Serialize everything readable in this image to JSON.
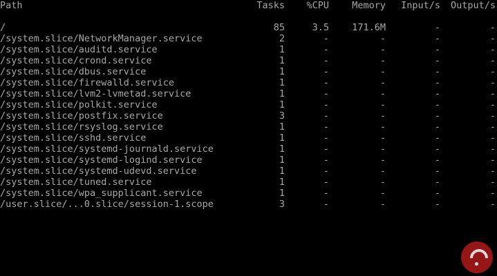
{
  "header": {
    "path": "Path",
    "tasks": "Tasks",
    "cpu": "%CPU",
    "memory": "Memory",
    "input": "Input/s",
    "output": "Output/s"
  },
  "rows": [
    {
      "path": "/",
      "tasks": "85",
      "cpu": "3.5",
      "memory": "171.6M",
      "input": "-",
      "output": "-"
    },
    {
      "path": "/system.slice/NetworkManager.service",
      "tasks": "2",
      "cpu": "-",
      "memory": "-",
      "input": "-",
      "output": "-"
    },
    {
      "path": "/system.slice/auditd.service",
      "tasks": "1",
      "cpu": "-",
      "memory": "-",
      "input": "-",
      "output": "-"
    },
    {
      "path": "/system.slice/crond.service",
      "tasks": "1",
      "cpu": "-",
      "memory": "-",
      "input": "-",
      "output": "-"
    },
    {
      "path": "/system.slice/dbus.service",
      "tasks": "1",
      "cpu": "-",
      "memory": "-",
      "input": "-",
      "output": "-"
    },
    {
      "path": "/system.slice/firewalld.service",
      "tasks": "1",
      "cpu": "-",
      "memory": "-",
      "input": "-",
      "output": "-"
    },
    {
      "path": "/system.slice/lvm2-lvmetad.service",
      "tasks": "1",
      "cpu": "-",
      "memory": "-",
      "input": "-",
      "output": "-"
    },
    {
      "path": "/system.slice/polkit.service",
      "tasks": "1",
      "cpu": "-",
      "memory": "-",
      "input": "-",
      "output": "-"
    },
    {
      "path": "/system.slice/postfix.service",
      "tasks": "3",
      "cpu": "-",
      "memory": "-",
      "input": "-",
      "output": "-"
    },
    {
      "path": "/system.slice/rsyslog.service",
      "tasks": "1",
      "cpu": "-",
      "memory": "-",
      "input": "-",
      "output": "-"
    },
    {
      "path": "/system.slice/sshd.service",
      "tasks": "1",
      "cpu": "-",
      "memory": "-",
      "input": "-",
      "output": "-"
    },
    {
      "path": "/system.slice/systemd-journald.service",
      "tasks": "1",
      "cpu": "-",
      "memory": "-",
      "input": "-",
      "output": "-"
    },
    {
      "path": "/system.slice/systemd-logind.service",
      "tasks": "1",
      "cpu": "-",
      "memory": "-",
      "input": "-",
      "output": "-"
    },
    {
      "path": "/system.slice/systemd-udevd.service",
      "tasks": "1",
      "cpu": "-",
      "memory": "-",
      "input": "-",
      "output": "-"
    },
    {
      "path": "/system.slice/tuned.service",
      "tasks": "1",
      "cpu": "-",
      "memory": "-",
      "input": "-",
      "output": "-"
    },
    {
      "path": "/system.slice/wpa_supplicant.service",
      "tasks": "1",
      "cpu": "-",
      "memory": "-",
      "input": "-",
      "output": "-"
    },
    {
      "path": "/user.slice/...0.slice/session-1.scope",
      "tasks": "3",
      "cpu": "-",
      "memory": "-",
      "input": "-",
      "output": "-"
    }
  ],
  "colors": {
    "background": "#000000",
    "text": "#a8a8a8",
    "watermark": "#b01a1a"
  },
  "icons": {
    "watermark": "question-mark-logo-icon"
  }
}
